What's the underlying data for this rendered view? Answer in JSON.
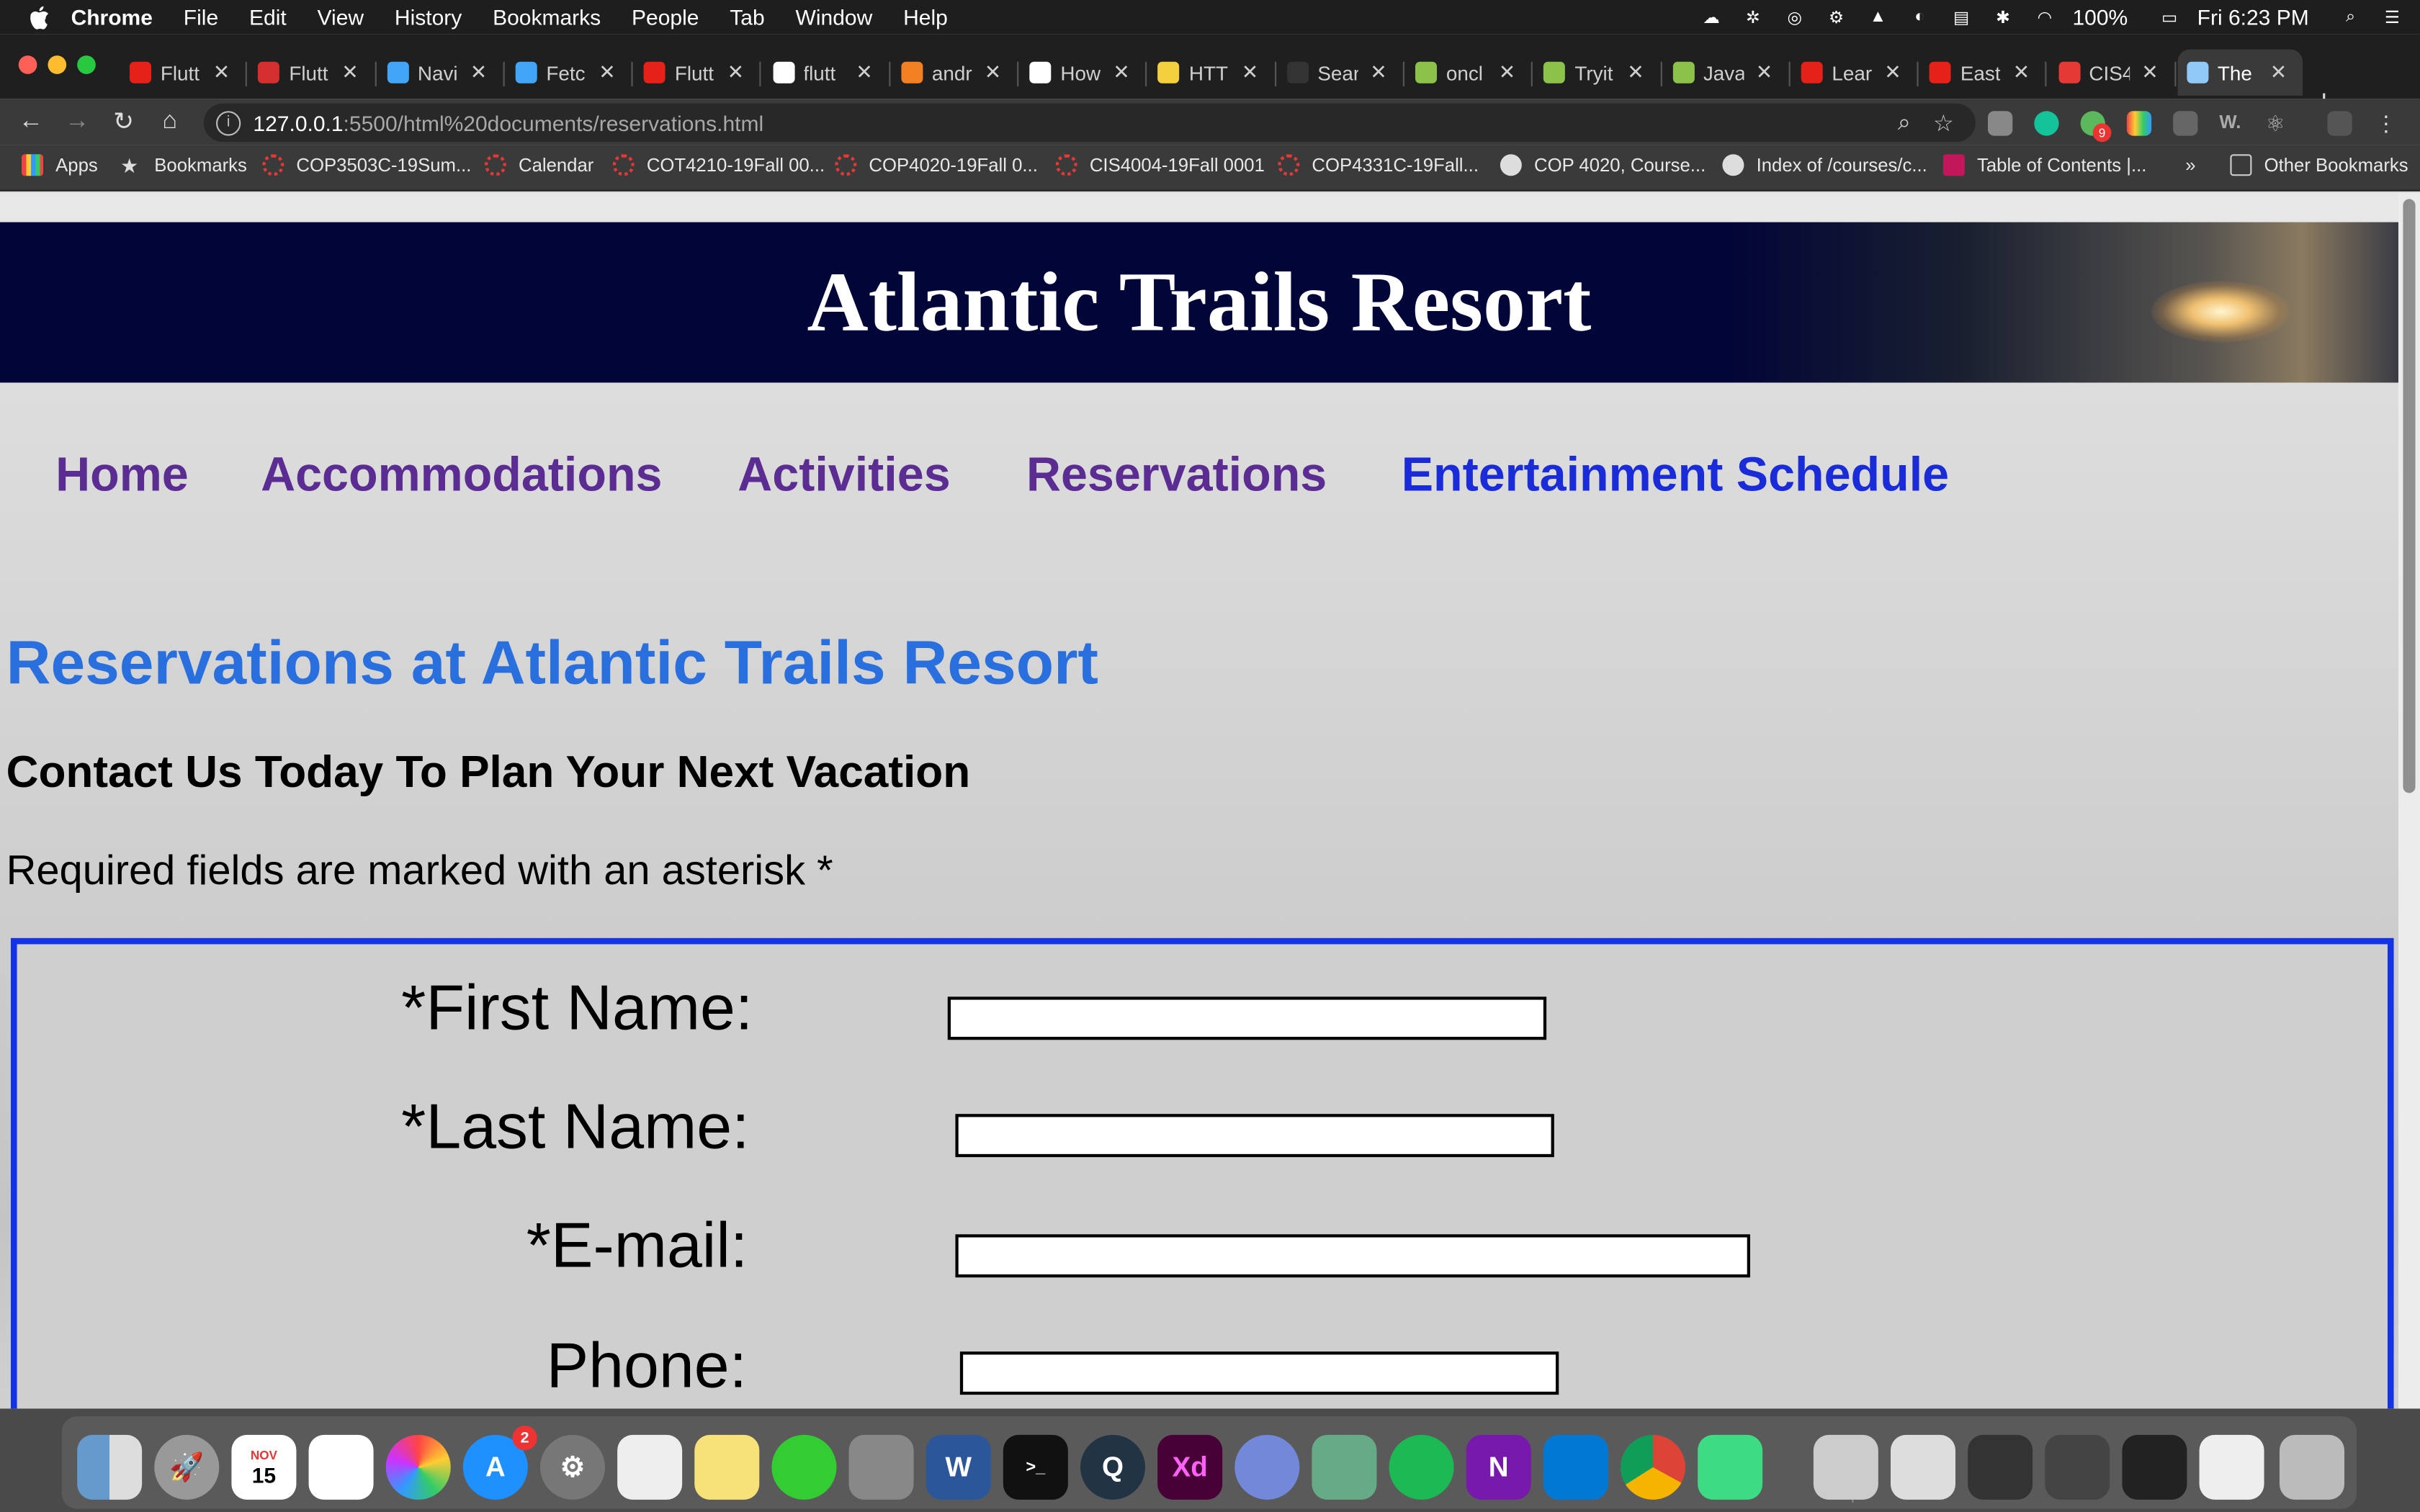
{
  "menubar": {
    "items": [
      "Chrome",
      "File",
      "Edit",
      "View",
      "History",
      "Bookmarks",
      "People",
      "Tab",
      "Window",
      "Help"
    ],
    "battery": "100%",
    "clock": "Fri 6:23 PM"
  },
  "tabs": [
    {
      "title": "Flutt",
      "icon_color": "#e62117"
    },
    {
      "title": "Flutt",
      "icon_color": "#d32f2f"
    },
    {
      "title": "Navi",
      "icon_color": "#42a5f5"
    },
    {
      "title": "Fetc",
      "icon_color": "#42a5f5"
    },
    {
      "title": "Flutt",
      "icon_color": "#e62117"
    },
    {
      "title": "flutt",
      "icon_color": "#ffffff"
    },
    {
      "title": "andr",
      "icon_color": "#f48024"
    },
    {
      "title": "How",
      "icon_color": "#ffffff"
    },
    {
      "title": "HTT",
      "icon_color": "#f4d03f"
    },
    {
      "title": "Sear",
      "icon_color": "#333333"
    },
    {
      "title": "oncl",
      "icon_color": "#8bc34a"
    },
    {
      "title": "Tryit",
      "icon_color": "#8bc34a"
    },
    {
      "title": "Java",
      "icon_color": "#8bc34a"
    },
    {
      "title": "Lear",
      "icon_color": "#e62117"
    },
    {
      "title": "East",
      "icon_color": "#e62117"
    },
    {
      "title": "CIS4",
      "icon_color": "#e53935"
    },
    {
      "title": "The",
      "icon_color": "#90caf9"
    }
  ],
  "address": {
    "host": "127.0.0.1",
    "path": ":5500/html%20documents/reservations.html"
  },
  "bookmarks": [
    "Apps",
    "Bookmarks",
    "COP3503C-19Sum...",
    "Calendar",
    "COT4210-19Fall 00...",
    "COP4020-19Fall 0...",
    "CIS4004-19Fall 0001",
    "COP4331C-19Fall...",
    "COP 4020, Course...",
    "Index of /courses/c...",
    "Table of Contents |..."
  ],
  "bookmarks_more": "»",
  "other_bookmarks": "Other Bookmarks",
  "site": {
    "title": "Atlantic Trails Resort",
    "nav": [
      "Home",
      "Accommodations",
      "Activities",
      "Reservations",
      "Entertainment Schedule"
    ],
    "heading": "Reservations at Atlantic Trails Resort",
    "subheading": "Contact Us Today To Plan Your Next Vacation",
    "note": "Required fields are marked with an asterisk *",
    "form": {
      "first_name": "*First Name:",
      "last_name": "*Last Name:",
      "email": "*E-mail:",
      "phone": "Phone:"
    }
  },
  "dock": {
    "calendar_month": "NOV",
    "calendar_day": "15",
    "appstore_badge": "2",
    "ext_badge": "9"
  },
  "colors": {
    "header_bg": "#020537",
    "nav_visited": "#5b2c91",
    "nav_link": "#1a2cd8",
    "heading": "#2a6fde",
    "form_border": "#1533e6"
  }
}
